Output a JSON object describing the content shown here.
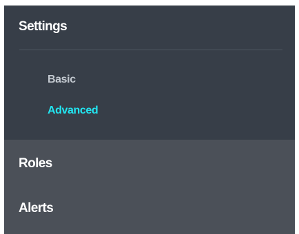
{
  "nav": {
    "settings": {
      "label": "Settings",
      "children": [
        {
          "label": "Basic",
          "state": "inactive"
        },
        {
          "label": "Advanced",
          "state": "active"
        }
      ]
    },
    "items": [
      {
        "label": "Roles"
      },
      {
        "label": "Alerts"
      }
    ]
  },
  "colors": {
    "settings_bg": "#373e48",
    "lower_bg": "#4b5058",
    "active_accent": "#22e6f2",
    "inactive_sub": "#c3c9d0",
    "text_primary": "#ffffff"
  }
}
